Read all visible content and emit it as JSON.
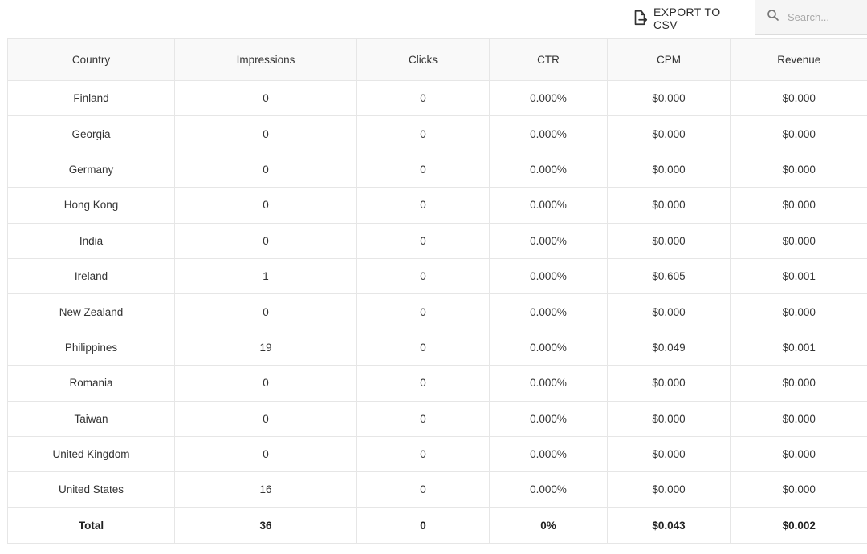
{
  "toolbar": {
    "export_label": "EXPORT TO CSV",
    "export_icon": "file-export-icon",
    "search_icon": "search-icon",
    "search_placeholder": "Search...",
    "search_value": ""
  },
  "table": {
    "columns": [
      "Country",
      "Impressions",
      "Clicks",
      "CTR",
      "CPM",
      "Revenue"
    ],
    "rows": [
      [
        "Finland",
        "0",
        "0",
        "0.000%",
        "$0.000",
        "$0.000"
      ],
      [
        "Georgia",
        "0",
        "0",
        "0.000%",
        "$0.000",
        "$0.000"
      ],
      [
        "Germany",
        "0",
        "0",
        "0.000%",
        "$0.000",
        "$0.000"
      ],
      [
        "Hong Kong",
        "0",
        "0",
        "0.000%",
        "$0.000",
        "$0.000"
      ],
      [
        "India",
        "0",
        "0",
        "0.000%",
        "$0.000",
        "$0.000"
      ],
      [
        "Ireland",
        "1",
        "0",
        "0.000%",
        "$0.605",
        "$0.001"
      ],
      [
        "New Zealand",
        "0",
        "0",
        "0.000%",
        "$0.000",
        "$0.000"
      ],
      [
        "Philippines",
        "19",
        "0",
        "0.000%",
        "$0.049",
        "$0.001"
      ],
      [
        "Romania",
        "0",
        "0",
        "0.000%",
        "$0.000",
        "$0.000"
      ],
      [
        "Taiwan",
        "0",
        "0",
        "0.000%",
        "$0.000",
        "$0.000"
      ],
      [
        "United Kingdom",
        "0",
        "0",
        "0.000%",
        "$0.000",
        "$0.000"
      ],
      [
        "United States",
        "16",
        "0",
        "0.000%",
        "$0.000",
        "$0.000"
      ]
    ],
    "total": [
      "Total",
      "36",
      "0",
      "0%",
      "$0.043",
      "$0.002"
    ]
  }
}
